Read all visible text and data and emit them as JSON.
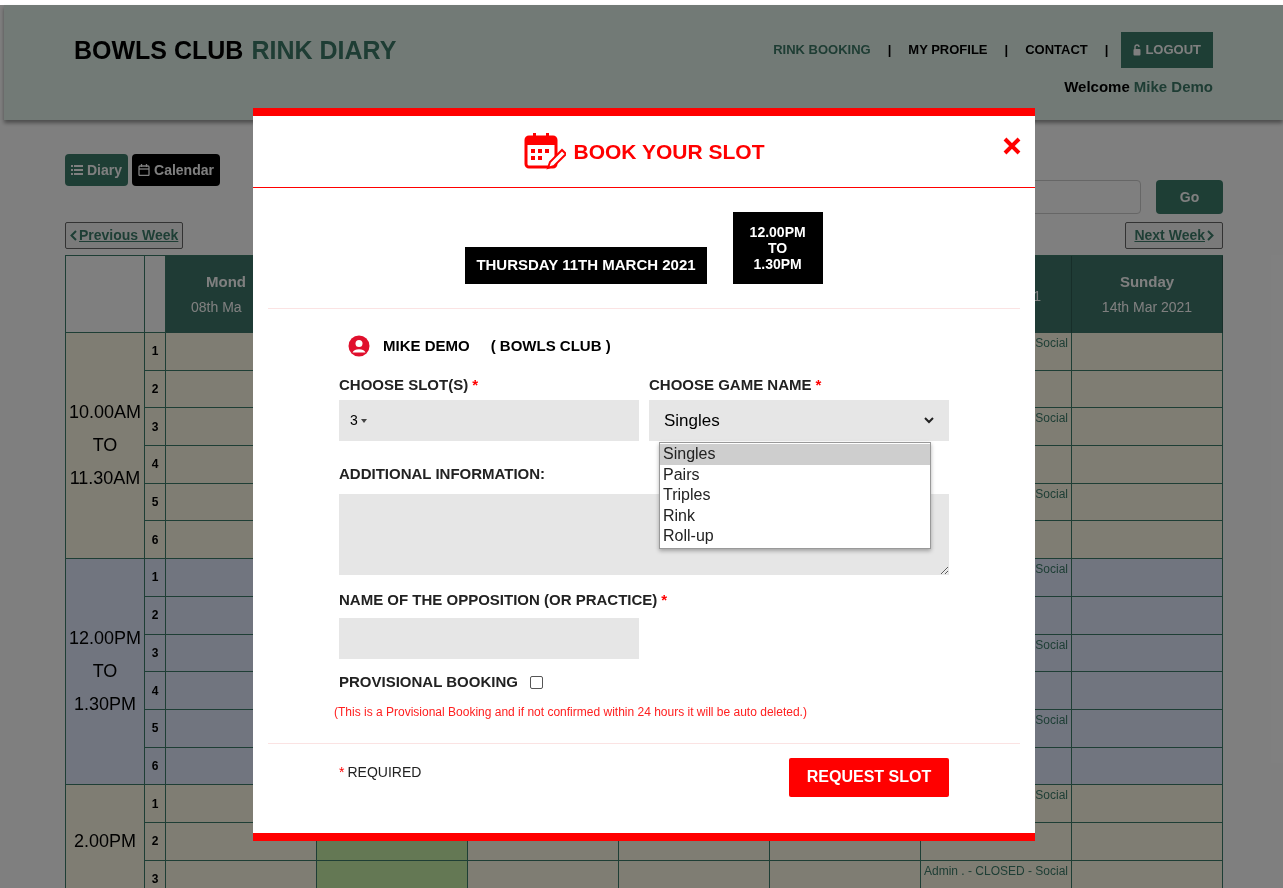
{
  "header": {
    "title_part1": "BOWLS CLUB",
    "title_part2": "RINK DIARY",
    "nav": [
      {
        "label": "RINK BOOKING",
        "selected": true
      },
      {
        "label": "MY PROFILE",
        "selected": false
      },
      {
        "label": "CONTACT",
        "selected": false
      }
    ],
    "nav_separators": [
      "|",
      "|",
      "|"
    ],
    "logout_button": "LOGOUT",
    "welcome": "Welcome",
    "user_name": "Mike Demo"
  },
  "view_buttons": [
    {
      "label": "Diary",
      "kind": "list",
      "selected": false
    },
    {
      "label": "Calendar",
      "kind": "calendar",
      "selected": true
    }
  ],
  "go_button": "Go",
  "previous_week": "Previous Week",
  "next_week": "Next Week",
  "diary": {
    "columns": [
      {
        "day": "Mond",
        "date": "08th Ma"
      },
      {},
      {},
      {},
      {},
      {
        "date": "1"
      },
      {
        "day": "Sunday",
        "date": "14th Mar 2021"
      }
    ],
    "blocks": [
      {
        "time": [
          "10.00AM",
          "TO",
          "11.30AM"
        ],
        "rinks": [
          {
            "number": "1",
            "saturday_note": "Social"
          },
          {
            "number": "2"
          },
          {
            "number": "3",
            "saturday_note": "Social"
          },
          {
            "number": "4"
          },
          {
            "number": "5",
            "saturday_note": "Social"
          },
          {
            "number": "6"
          }
        ]
      },
      {
        "time": [
          "12.00PM",
          "TO",
          "1.30PM"
        ],
        "rinks": [
          {
            "number": "1",
            "saturday_note": "Social"
          },
          {
            "number": "2"
          },
          {
            "number": "3",
            "saturday_note": "Social"
          },
          {
            "number": "4"
          },
          {
            "number": "5",
            "saturday_note": "Social"
          },
          {
            "number": "6"
          }
        ]
      },
      {
        "time": [
          "2.00PM"
        ],
        "tuesday_booked": true,
        "rinks": [
          {
            "number": "1",
            "saturday_note": "Social"
          },
          {
            "number": "2"
          },
          {
            "number": "3",
            "saturday_note": "Admin . - CLOSED - Social"
          }
        ]
      }
    ]
  },
  "modal": {
    "title": "BOOK YOUR SLOT",
    "date": "THURSDAY 11TH MARCH 2021",
    "time": [
      "12.00PM",
      "TO",
      "1.30PM"
    ],
    "user": "MIKE DEMO",
    "club": "( BOWLS CLUB )",
    "slots": {
      "label": "CHOOSE SLOT(S)",
      "required_mark": "*",
      "value": "3"
    },
    "game": {
      "label": "CHOOSE GAME NAME",
      "required_mark": "*",
      "value": "Singles",
      "expanded": true,
      "options": [
        {
          "label": "Singles",
          "selected": true
        },
        {
          "label": "Pairs",
          "selected": false
        },
        {
          "label": "Triples",
          "selected": false
        },
        {
          "label": "Rink",
          "selected": false
        },
        {
          "label": "Roll-up",
          "selected": false
        }
      ]
    },
    "additional": {
      "label": "ADDITIONAL INFORMATION:"
    },
    "opposition": {
      "label": "NAME OF THE OPPOSITION (OR PRACTICE)",
      "required_mark": "*"
    },
    "provisional": {
      "label": "PROVISIONAL BOOKING",
      "checked": false
    },
    "note": "(This is a Provisional Booking and if not confirmed within 24 hours it will be auto deleted.)",
    "required_note": {
      "mark": "*",
      "text": "REQUIRED"
    },
    "submit": "REQUEST SLOT"
  }
}
